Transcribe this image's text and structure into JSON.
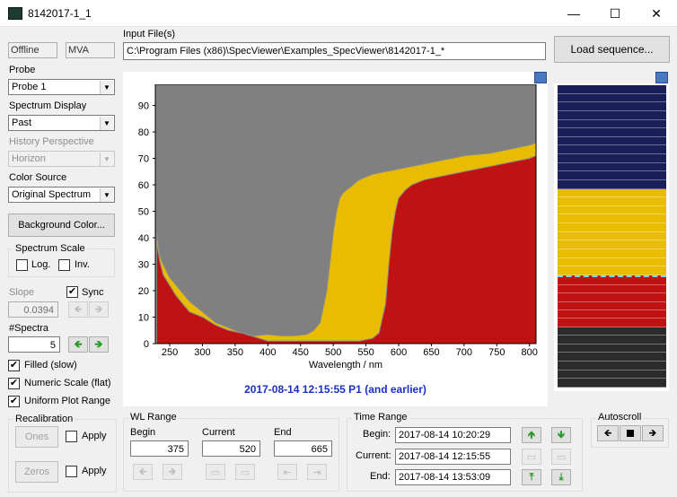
{
  "window": {
    "title": "8142017-1_1",
    "minimize": "—",
    "maximize": "☐",
    "close": "✕"
  },
  "status": {
    "offline": "Offline",
    "mode": "MVA"
  },
  "input": {
    "label": "Input File(s)",
    "value": "C:\\Program Files (x86)\\SpecViewer\\Examples_SpecViewer\\8142017-1_*",
    "load_button": "Load sequence..."
  },
  "probe": {
    "label": "Probe",
    "value": "Probe 1"
  },
  "spectrum_display": {
    "label": "Spectrum Display",
    "value": "Past"
  },
  "history_perspective": {
    "label": "History Perspective",
    "value": "Horizon"
  },
  "color_source": {
    "label": "Color Source",
    "value": "Original Spectrum"
  },
  "background_button": "Background Color...",
  "spectrum_scale": {
    "title": "Spectrum Scale",
    "log": "Log.",
    "inv": "Inv."
  },
  "slope": {
    "label": "Slope",
    "value": "0.0394",
    "sync": "Sync"
  },
  "spectra": {
    "label": "#Spectra",
    "value": "5"
  },
  "options": {
    "filled": "Filled (slow)",
    "numeric_scale": "Numeric Scale (flat)",
    "uniform_range": "Uniform Plot Range"
  },
  "recalibration": {
    "title": "Recalibration",
    "ones": "Ones",
    "zeros": "Zeros",
    "apply": "Apply"
  },
  "wl_range": {
    "title": "WL Range",
    "begin_label": "Begin",
    "current_label": "Current",
    "end_label": "End",
    "begin": "375",
    "current": "520",
    "end": "665"
  },
  "time_range": {
    "title": "Time Range",
    "begin_label": "Begin:",
    "current_label": "Current:",
    "end_label": "End:",
    "begin": "2017-08-14 10:20:29",
    "current": "2017-08-14 12:15:55",
    "end": "2017-08-14 13:53:09"
  },
  "autoscroll": {
    "title": "Autoscroll"
  },
  "chart_caption": "2017-08-14 12:15:55 P1 (and earlier)",
  "chart_data": {
    "type": "area",
    "xlabel": "Wavelength / nm",
    "ylabel": "",
    "xlim": [
      228,
      810
    ],
    "ylim": [
      0,
      98
    ],
    "xticks": [
      250,
      300,
      350,
      400,
      450,
      500,
      550,
      600,
      650,
      700,
      750,
      800
    ],
    "yticks": [
      0,
      10,
      20,
      30,
      40,
      50,
      60,
      70,
      80,
      90
    ],
    "series": [
      {
        "color": "#e8bc00",
        "x": [
          230,
          235,
          240,
          250,
          260,
          270,
          280,
          300,
          320,
          340,
          360,
          380,
          400,
          420,
          440,
          460,
          470,
          480,
          490,
          500,
          505,
          510,
          515,
          520,
          530,
          540,
          550,
          560,
          580,
          600,
          620,
          640,
          660,
          680,
          700,
          720,
          740,
          760,
          780,
          800,
          810
        ],
        "y": [
          42,
          33,
          30,
          25,
          22,
          19,
          16,
          12,
          8,
          6,
          4,
          3,
          3.5,
          3,
          3,
          3.5,
          5,
          8,
          20,
          42,
          50,
          55,
          57,
          58,
          60,
          62,
          63,
          64,
          65,
          66,
          67,
          68,
          69,
          70,
          71,
          71.5,
          72,
          73,
          74,
          75,
          76
        ]
      },
      {
        "color": "#c01212",
        "x": [
          230,
          235,
          240,
          250,
          260,
          270,
          280,
          300,
          320,
          340,
          360,
          380,
          400,
          420,
          440,
          460,
          480,
          500,
          520,
          540,
          560,
          570,
          580,
          585,
          590,
          595,
          600,
          610,
          620,
          640,
          660,
          680,
          700,
          720,
          740,
          760,
          780,
          800,
          810
        ],
        "y": [
          38,
          31,
          26,
          22,
          18,
          15,
          12,
          10,
          7,
          5,
          4,
          2.5,
          1,
          1,
          1,
          1,
          1,
          1,
          1,
          1,
          2,
          4,
          15,
          30,
          42,
          50,
          55,
          58,
          60,
          62,
          63,
          64,
          65,
          66,
          67,
          68,
          69,
          70,
          71
        ]
      }
    ]
  },
  "history_bands": [
    {
      "color": "#1a1f5a",
      "lines": 12
    },
    {
      "color": "#e8bc00",
      "lines": 10
    },
    {
      "color": "#c01212",
      "lines": 6
    },
    {
      "color": "#2b2b2b",
      "lines": 7
    }
  ]
}
